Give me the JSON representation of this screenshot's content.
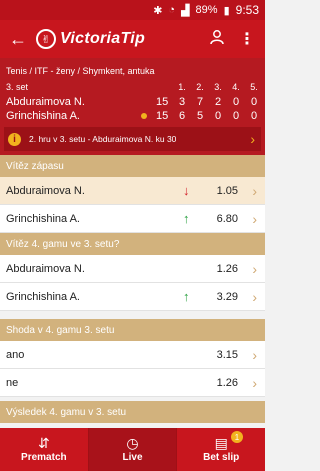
{
  "status": {
    "battery": "89%",
    "time": "9:53"
  },
  "app": {
    "brand": "VictoriaTip"
  },
  "match": {
    "path": "Tenis / ITF - ženy / Shymkent, antuka",
    "set_label": "3. set",
    "col_headers": [
      "1.",
      "2.",
      "3.",
      "4.",
      "5."
    ],
    "players": [
      {
        "name": "Abduraimova N.",
        "scores": [
          "15",
          "3",
          "7",
          "2",
          "0",
          "0"
        ]
      },
      {
        "name": "Grinchishina A.",
        "scores": [
          "15",
          "6",
          "5",
          "0",
          "0",
          "0"
        ]
      }
    ],
    "info": "2. hru v 3. setu - Abduraimova N. ku 30"
  },
  "markets": [
    {
      "title": "Vítěz zápasu",
      "outcomes": [
        {
          "label": "Abduraimova N.",
          "odd": "1.05",
          "trend": "down"
        },
        {
          "label": "Grinchishina A.",
          "odd": "6.80",
          "trend": "up"
        }
      ]
    },
    {
      "title": "Vítěz 4. gamu ve 3. setu?",
      "outcomes": [
        {
          "label": "Abduraimova N.",
          "odd": "1.26",
          "trend": ""
        },
        {
          "label": "Grinchishina A.",
          "odd": "3.29",
          "trend": "up"
        }
      ]
    },
    {
      "title": "Shoda v 4. gamu 3. setu",
      "outcomes": [
        {
          "label": "ano",
          "odd": "3.15",
          "trend": ""
        },
        {
          "label": "ne",
          "odd": "1.26",
          "trend": ""
        }
      ]
    },
    {
      "title": "Výsledek 4. gamu v 3. setu",
      "outcomes": []
    }
  ],
  "nav": {
    "prematch": "Prematch",
    "live": "Live",
    "betslip": "Bet slip",
    "betslip_count": "1"
  }
}
